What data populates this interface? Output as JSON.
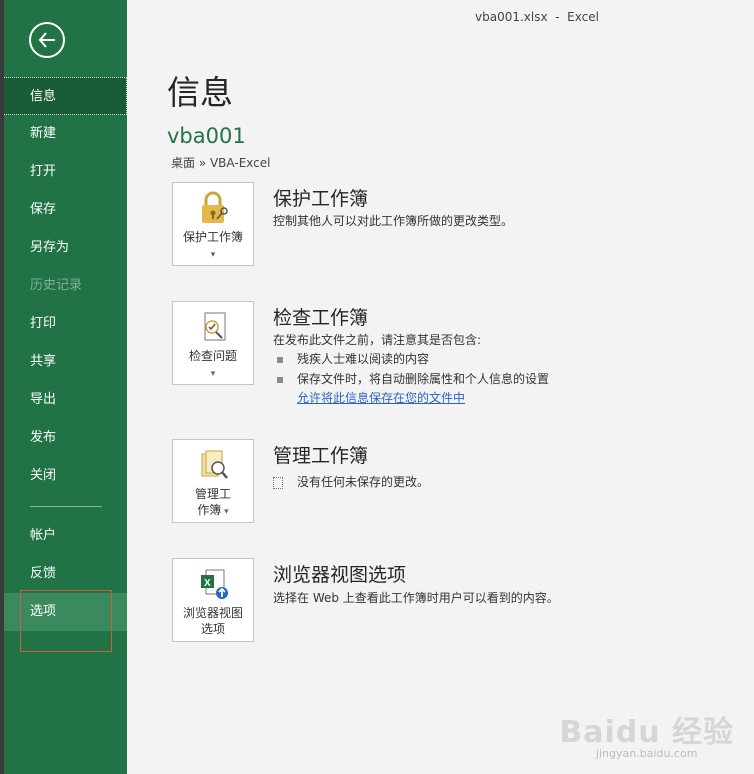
{
  "window": {
    "title": "vba001.xlsx  -  Excel"
  },
  "nav": {
    "items": [
      {
        "label": "信息",
        "state": "active"
      },
      {
        "label": "新建",
        "state": "normal"
      },
      {
        "label": "打开",
        "state": "normal"
      },
      {
        "label": "保存",
        "state": "normal"
      },
      {
        "label": "另存为",
        "state": "normal"
      },
      {
        "label": "历史记录",
        "state": "disabled"
      },
      {
        "label": "打印",
        "state": "normal"
      },
      {
        "label": "共享",
        "state": "normal"
      },
      {
        "label": "导出",
        "state": "normal"
      },
      {
        "label": "发布",
        "state": "normal"
      },
      {
        "label": "关闭",
        "state": "normal"
      },
      {
        "label": "帐户",
        "state": "normal"
      },
      {
        "label": "反馈",
        "state": "normal"
      },
      {
        "label": "选项",
        "state": "hovered"
      }
    ]
  },
  "main": {
    "page_title": "信息",
    "doc_name": "vba001",
    "doc_path": "桌面 » VBA-Excel",
    "sections": {
      "protect": {
        "button_label": "保护工作簿",
        "title": "保护工作簿",
        "description": "控制其他人可以对此工作簿所做的更改类型。"
      },
      "inspect": {
        "button_label": "检查问题",
        "title": "检查工作簿",
        "description": "在发布此文件之前，请注意其是否包含:",
        "bullets": [
          "残疾人士难以阅读的内容",
          "保存文件时，将自动删除属性和个人信息的设置"
        ],
        "link": "允许将此信息保存在您的文件中"
      },
      "manage": {
        "button_label_1": "管理工",
        "button_label_2": "作簿",
        "title": "管理工作簿",
        "note": "没有任何未保存的更改。"
      },
      "browser": {
        "button_label_1": "浏览器视图",
        "button_label_2": "选项",
        "title": "浏览器视图选项",
        "description": "选择在 Web 上查看此工作簿时用户可以看到的内容。"
      }
    }
  },
  "watermark": {
    "logo": "Baidu 经验",
    "url": "jingyan.baidu.com"
  },
  "colors": {
    "nav_bg": "#217346",
    "accent": "#217346",
    "link": "#2a64c5",
    "highlight_box": "#d05a42"
  },
  "icons": [
    "back-arrow-icon",
    "lock-key-icon",
    "inspect-doc-icon",
    "manage-workbook-icon",
    "browser-view-icon"
  ]
}
